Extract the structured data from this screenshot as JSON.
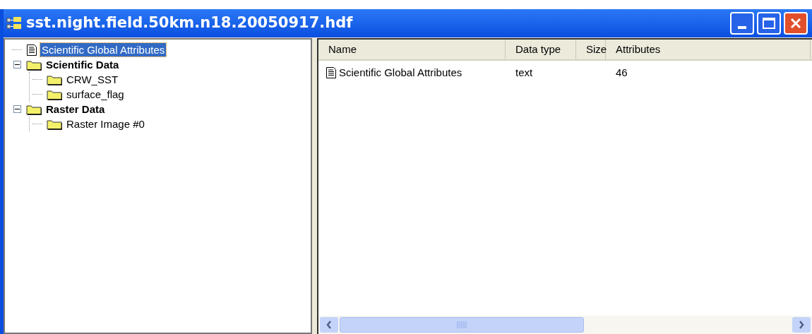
{
  "window": {
    "title": "sst.night.field.50km.n18.20050917.hdf"
  },
  "tree": [
    {
      "label": "Scientific Global Attributes",
      "kind": "attributes",
      "selected": true
    },
    {
      "label": "Scientific Data",
      "kind": "group",
      "selected": false,
      "expanded": true,
      "children": [
        {
          "label": "CRW_SST",
          "kind": "dataset",
          "selected": false
        },
        {
          "label": "surface_flag",
          "kind": "dataset",
          "selected": false
        }
      ]
    },
    {
      "label": "Raster Data",
      "kind": "group",
      "selected": false,
      "expanded": true,
      "children": [
        {
          "label": "Raster Image #0",
          "kind": "dataset",
          "selected": false
        }
      ]
    }
  ],
  "table": {
    "columns": [
      "Name",
      "Data type",
      "Size",
      "Attributes"
    ],
    "rows": [
      {
        "kind": "attributes",
        "cells": [
          "Scientific Global Attributes",
          "text",
          "",
          "46"
        ]
      }
    ]
  }
}
